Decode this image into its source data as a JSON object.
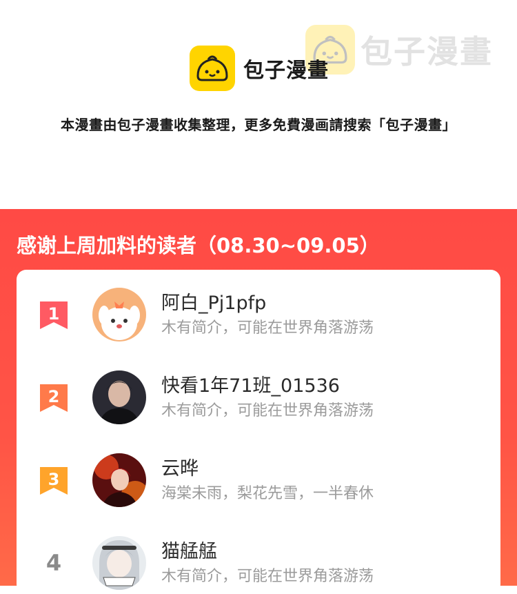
{
  "brand": {
    "name": "包子漫畫",
    "watermark": "包子漫畫"
  },
  "notice": "本漫畫由包子漫畫收集整理，更多免費漫画請搜索「包子漫畫」",
  "panel": {
    "title": "感谢上周加料的读者（08.30~09.05）"
  },
  "readers": [
    {
      "rank": "1",
      "name": "阿白_Pj1pfp",
      "bio": "木有简介，可能在世界角落游荡",
      "badge_color": "#ff5a63"
    },
    {
      "rank": "2",
      "name": "快看1年71班_01536",
      "bio": "木有简介，可能在世界角落游荡",
      "badge_color": "#ff7a4a"
    },
    {
      "rank": "3",
      "name": "云晔",
      "bio": "海棠未雨，梨花先雪，一半春休",
      "badge_color": "#ffa42b"
    },
    {
      "rank": "4",
      "name": "猫艋艋",
      "bio": "木有简介，可能在世界角落游荡",
      "badge_color": "#8a8a8a"
    }
  ],
  "colors": {
    "panel_bg": "#ff4a45",
    "brand_yellow": "#ffd400"
  }
}
